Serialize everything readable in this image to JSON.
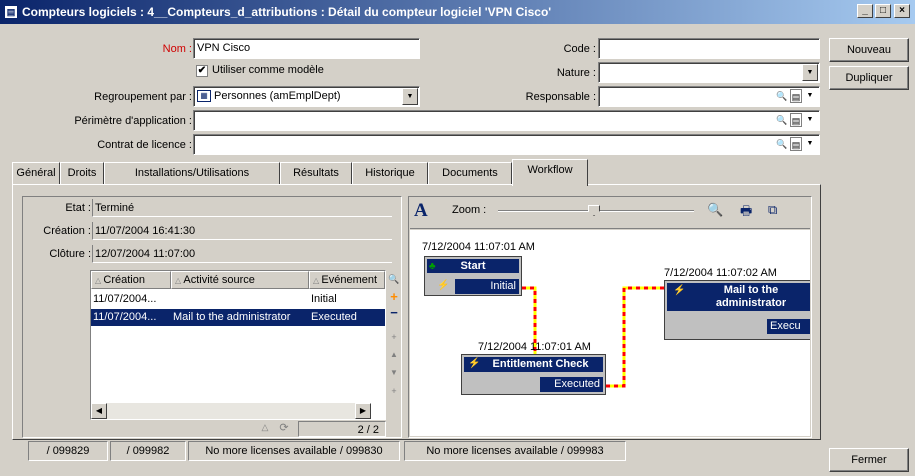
{
  "window": {
    "title": "Compteurs logiciels : 4__Compteurs_d_attributions : Détail du compteur logiciel 'VPN Cisco'",
    "min": "_",
    "max": "□",
    "close": "×"
  },
  "form": {
    "nom_label": "Nom :",
    "nom_value": "VPN Cisco",
    "template_checkbox_label": "Utiliser comme modèle",
    "template_checked": true,
    "regroupement_label": "Regroupement par :",
    "regroupement_value": "Personnes (amEmplDept)",
    "perimetre_label": "Périmètre d'application :",
    "perimetre_value": "",
    "contrat_label": "Contrat de licence :",
    "contrat_value": "",
    "code_label": "Code :",
    "code_value": "",
    "nature_label": "Nature :",
    "nature_value": "",
    "responsable_label": "Responsable :",
    "responsable_value": ""
  },
  "buttons": {
    "nouveau": "Nouveau",
    "dupliquer": "Dupliquer",
    "fermer": "Fermer"
  },
  "tabs": [
    {
      "label": "Général"
    },
    {
      "label": "Droits"
    },
    {
      "label": "Installations/Utilisations"
    },
    {
      "label": "Résultats"
    },
    {
      "label": "Historique"
    },
    {
      "label": "Documents"
    },
    {
      "label": "Workflow"
    }
  ],
  "workflow": {
    "etat_label": "Etat :",
    "etat_value": "Terminé",
    "creation_label": "Création :",
    "creation_value": "11/07/2004 16:41:30",
    "cloture_label": "Clôture :",
    "cloture_value": "12/07/2004 11:07:00",
    "grid": {
      "columns": [
        "Création",
        "Activité source",
        "Evénement"
      ],
      "rows": [
        {
          "creation": "11/07/2004...",
          "activite": "",
          "evenement": "Initial"
        },
        {
          "creation": "11/07/2004...",
          "activite": "Mail to the administrator",
          "evenement": "Executed"
        }
      ],
      "page": "2 / 2"
    },
    "zoom_label": "Zoom :",
    "zoom_level": 0.49,
    "diagram": {
      "nodes": [
        {
          "timestamp": "7/12/2004 11:07:01 AM",
          "title": "Start",
          "status": "Initial"
        },
        {
          "timestamp": "7/12/2004 11:07:01 AM",
          "title": "Entitlement Check",
          "status": "Executed"
        },
        {
          "timestamp": "7/12/2004 11:07:02 AM",
          "title": "Mail to the administrator",
          "status": "Execu"
        }
      ]
    }
  },
  "status_tabs": [
    {
      "label": "/ 099829"
    },
    {
      "label": "/ 099982"
    },
    {
      "label": "No more licenses available / 099830"
    },
    {
      "label": "No more licenses available / 099983"
    }
  ],
  "colors": {
    "title_start": "#0a246a",
    "title_end": "#a6caf0",
    "node_fill": "#0a246a",
    "link_dash": "#ff0000",
    "link_alt": "#ffff00",
    "selection": "#0a246a"
  },
  "icons": {
    "app": "app-icon",
    "zoom_fit": "zoom-icon",
    "print": "print-icon",
    "copy": "copy-icon",
    "font": "font-icon"
  }
}
